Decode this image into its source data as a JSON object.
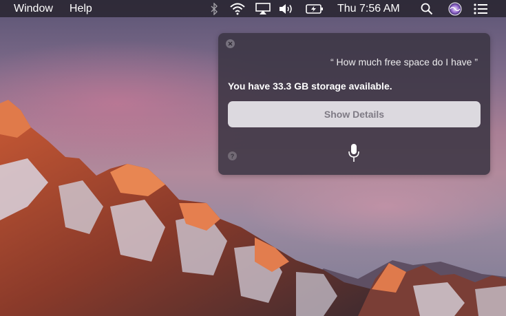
{
  "menubar": {
    "items": [
      {
        "label": "Window"
      },
      {
        "label": "Help"
      }
    ],
    "status_icons": [
      "bluetooth-icon",
      "wifi-icon",
      "airplay-icon",
      "volume-icon",
      "battery-charging-icon"
    ],
    "clock": "Thu 7:56 AM",
    "right_icons": [
      "spotlight-search-icon",
      "siri-icon",
      "notification-center-icon"
    ]
  },
  "siri": {
    "query": "“ How much free space do I have ”",
    "answer": "You have 33.3 GB storage available.",
    "details_button": "Show Details",
    "help_label": "?",
    "icons": [
      "close-icon",
      "microphone-icon"
    ]
  },
  "colors": {
    "menubar_bg": "#26222c",
    "panel_bg": "#3a3442",
    "button_bg": "#eceaf0",
    "button_text": "#7e7a84"
  }
}
